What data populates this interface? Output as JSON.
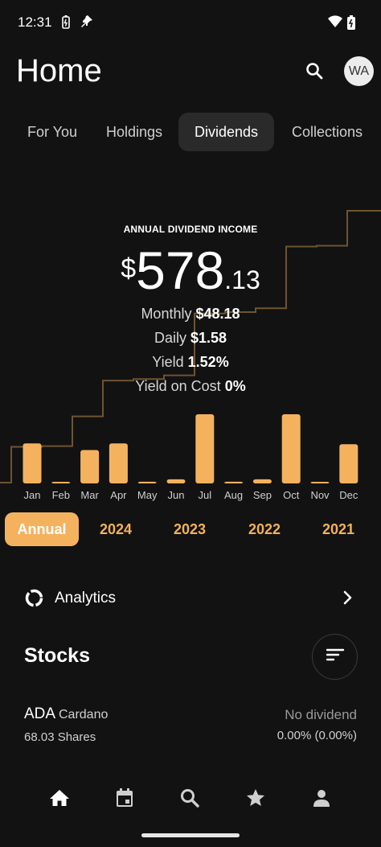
{
  "status_bar": {
    "time": "12:31"
  },
  "header": {
    "title": "Home",
    "avatar_initials": "WA"
  },
  "tabs": [
    {
      "label": "For You",
      "active": false
    },
    {
      "label": "Holdings",
      "active": false
    },
    {
      "label": "Dividends",
      "active": true
    },
    {
      "label": "Collections",
      "active": false
    }
  ],
  "summary": {
    "label": "ANNUAL DIVIDEND INCOME",
    "currency_symbol": "$",
    "amount_whole": "578",
    "amount_fraction": ".13",
    "monthly_label": "Monthly",
    "monthly_value": "$48.18",
    "daily_label": "Daily",
    "daily_value": "$1.58",
    "yield_label": "Yield",
    "yield_value": "1.52%",
    "yoc_label": "Yield on Cost",
    "yoc_value": "0%"
  },
  "chart_data": {
    "type": "bar",
    "categories": [
      "Jan",
      "Feb",
      "Mar",
      "Apr",
      "May",
      "Jun",
      "Jul",
      "Aug",
      "Sep",
      "Oct",
      "Nov",
      "Dec"
    ],
    "values": [
      48,
      1,
      40,
      48,
      2,
      5,
      83,
      2,
      5,
      83,
      1,
      47
    ],
    "cumulative_line": [
      48,
      49,
      89,
      137,
      139,
      144,
      227,
      229,
      234,
      317,
      318,
      365
    ],
    "colors": {
      "bar": "#f4b25f",
      "line": "#6e5430"
    }
  },
  "periods": [
    {
      "label": "Annual",
      "active": true
    },
    {
      "label": "2024",
      "active": false
    },
    {
      "label": "2023",
      "active": false
    },
    {
      "label": "2022",
      "active": false
    },
    {
      "label": "2021",
      "active": false
    }
  ],
  "analytics": {
    "label": "Analytics"
  },
  "stocks_section": {
    "title": "Stocks"
  },
  "stocks": [
    {
      "ticker": "ADA",
      "name": "Cardano",
      "shares": "68.03 Shares",
      "status": "No dividend",
      "yield": "0.00% (0.00%)"
    }
  ],
  "colors": {
    "accent": "#f4b25f",
    "background": "#121212"
  }
}
